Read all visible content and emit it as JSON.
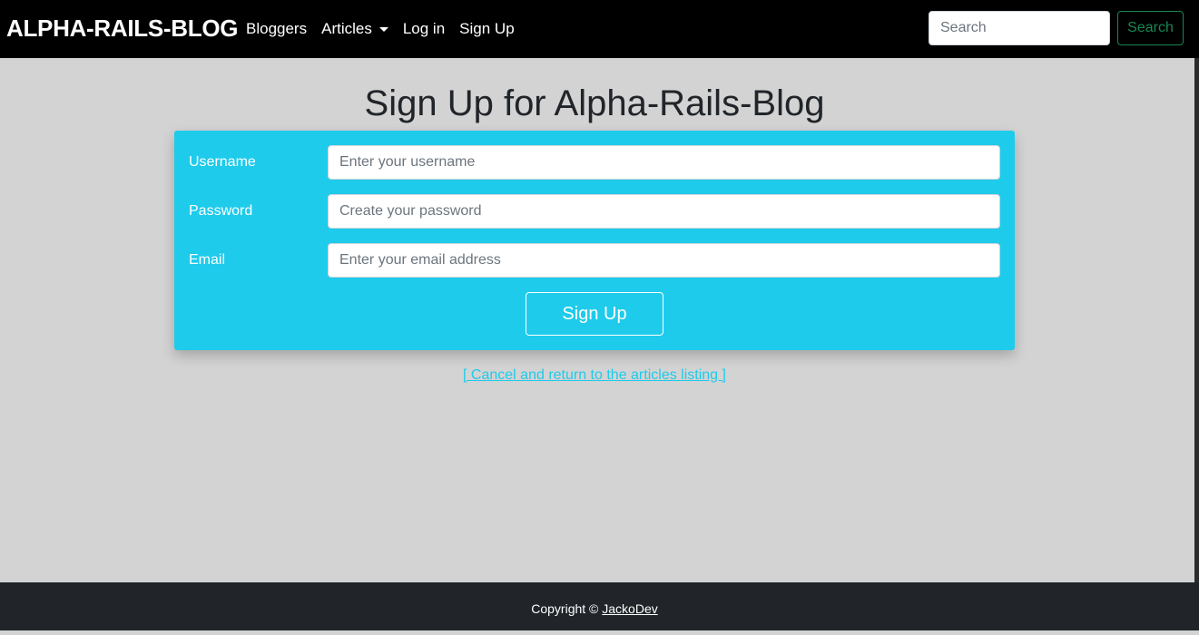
{
  "navbar": {
    "brand": "ALPHA-RAILS-BLOG",
    "links": {
      "bloggers": "Bloggers",
      "articles": "Articles",
      "login": "Log in",
      "signup": "Sign Up"
    },
    "search": {
      "placeholder": "Search",
      "button_label": "Search"
    }
  },
  "main": {
    "title": "Sign Up for Alpha-Rails-Blog",
    "form": {
      "username": {
        "label": "Username",
        "placeholder": "Enter your username",
        "value": ""
      },
      "password": {
        "label": "Password",
        "placeholder": "Create your password",
        "value": ""
      },
      "email": {
        "label": "Email",
        "placeholder": "Enter your email address",
        "value": ""
      },
      "submit_label": "Sign Up"
    },
    "cancel_link": "[ Cancel and return to the articles listing ]"
  },
  "footer": {
    "copyright": "Copyright © ",
    "author": "JackoDev"
  },
  "colors": {
    "navbar_bg": "#000000",
    "page_bg": "#d3d3d3",
    "card_bg": "#1ecbeb",
    "search_button": "#198754",
    "footer_bg": "#212529",
    "link": "#1ecbeb"
  },
  "icons": {
    "articles_dropdown": "caret-down-icon"
  }
}
